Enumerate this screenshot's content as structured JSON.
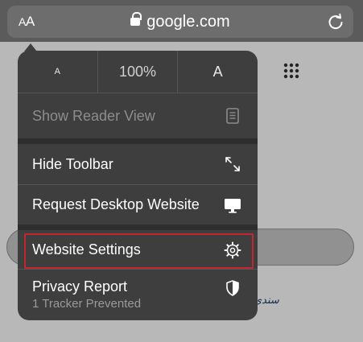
{
  "toolbar": {
    "aa_small": "A",
    "aa_large": "A",
    "url": "google.com",
    "lock_icon": "lock-icon",
    "reload_icon": "reload-icon"
  },
  "background_page": {
    "apps_icon": "apps-grid-icon",
    "arabic_snippet": "سندی"
  },
  "menu": {
    "zoom": {
      "decrease_label": "A",
      "level": "100%",
      "increase_label": "A"
    },
    "items": [
      {
        "label": "Show Reader View",
        "icon": "reader-view-icon",
        "enabled": false
      },
      {
        "label": "Hide Toolbar",
        "icon": "resize-arrows-icon",
        "enabled": true
      },
      {
        "label": "Request Desktop Website",
        "icon": "desktop-icon",
        "enabled": true
      },
      {
        "label": "Website Settings",
        "icon": "gear-icon",
        "enabled": true,
        "highlighted": true
      },
      {
        "label": "Privacy Report",
        "sublabel": "1 Tracker Prevented",
        "icon": "shield-icon",
        "enabled": true
      }
    ]
  },
  "colors": {
    "menu_bg": "#3e3e3e",
    "highlight_border": "#c2262e",
    "disabled_text": "#8c8c8c"
  }
}
